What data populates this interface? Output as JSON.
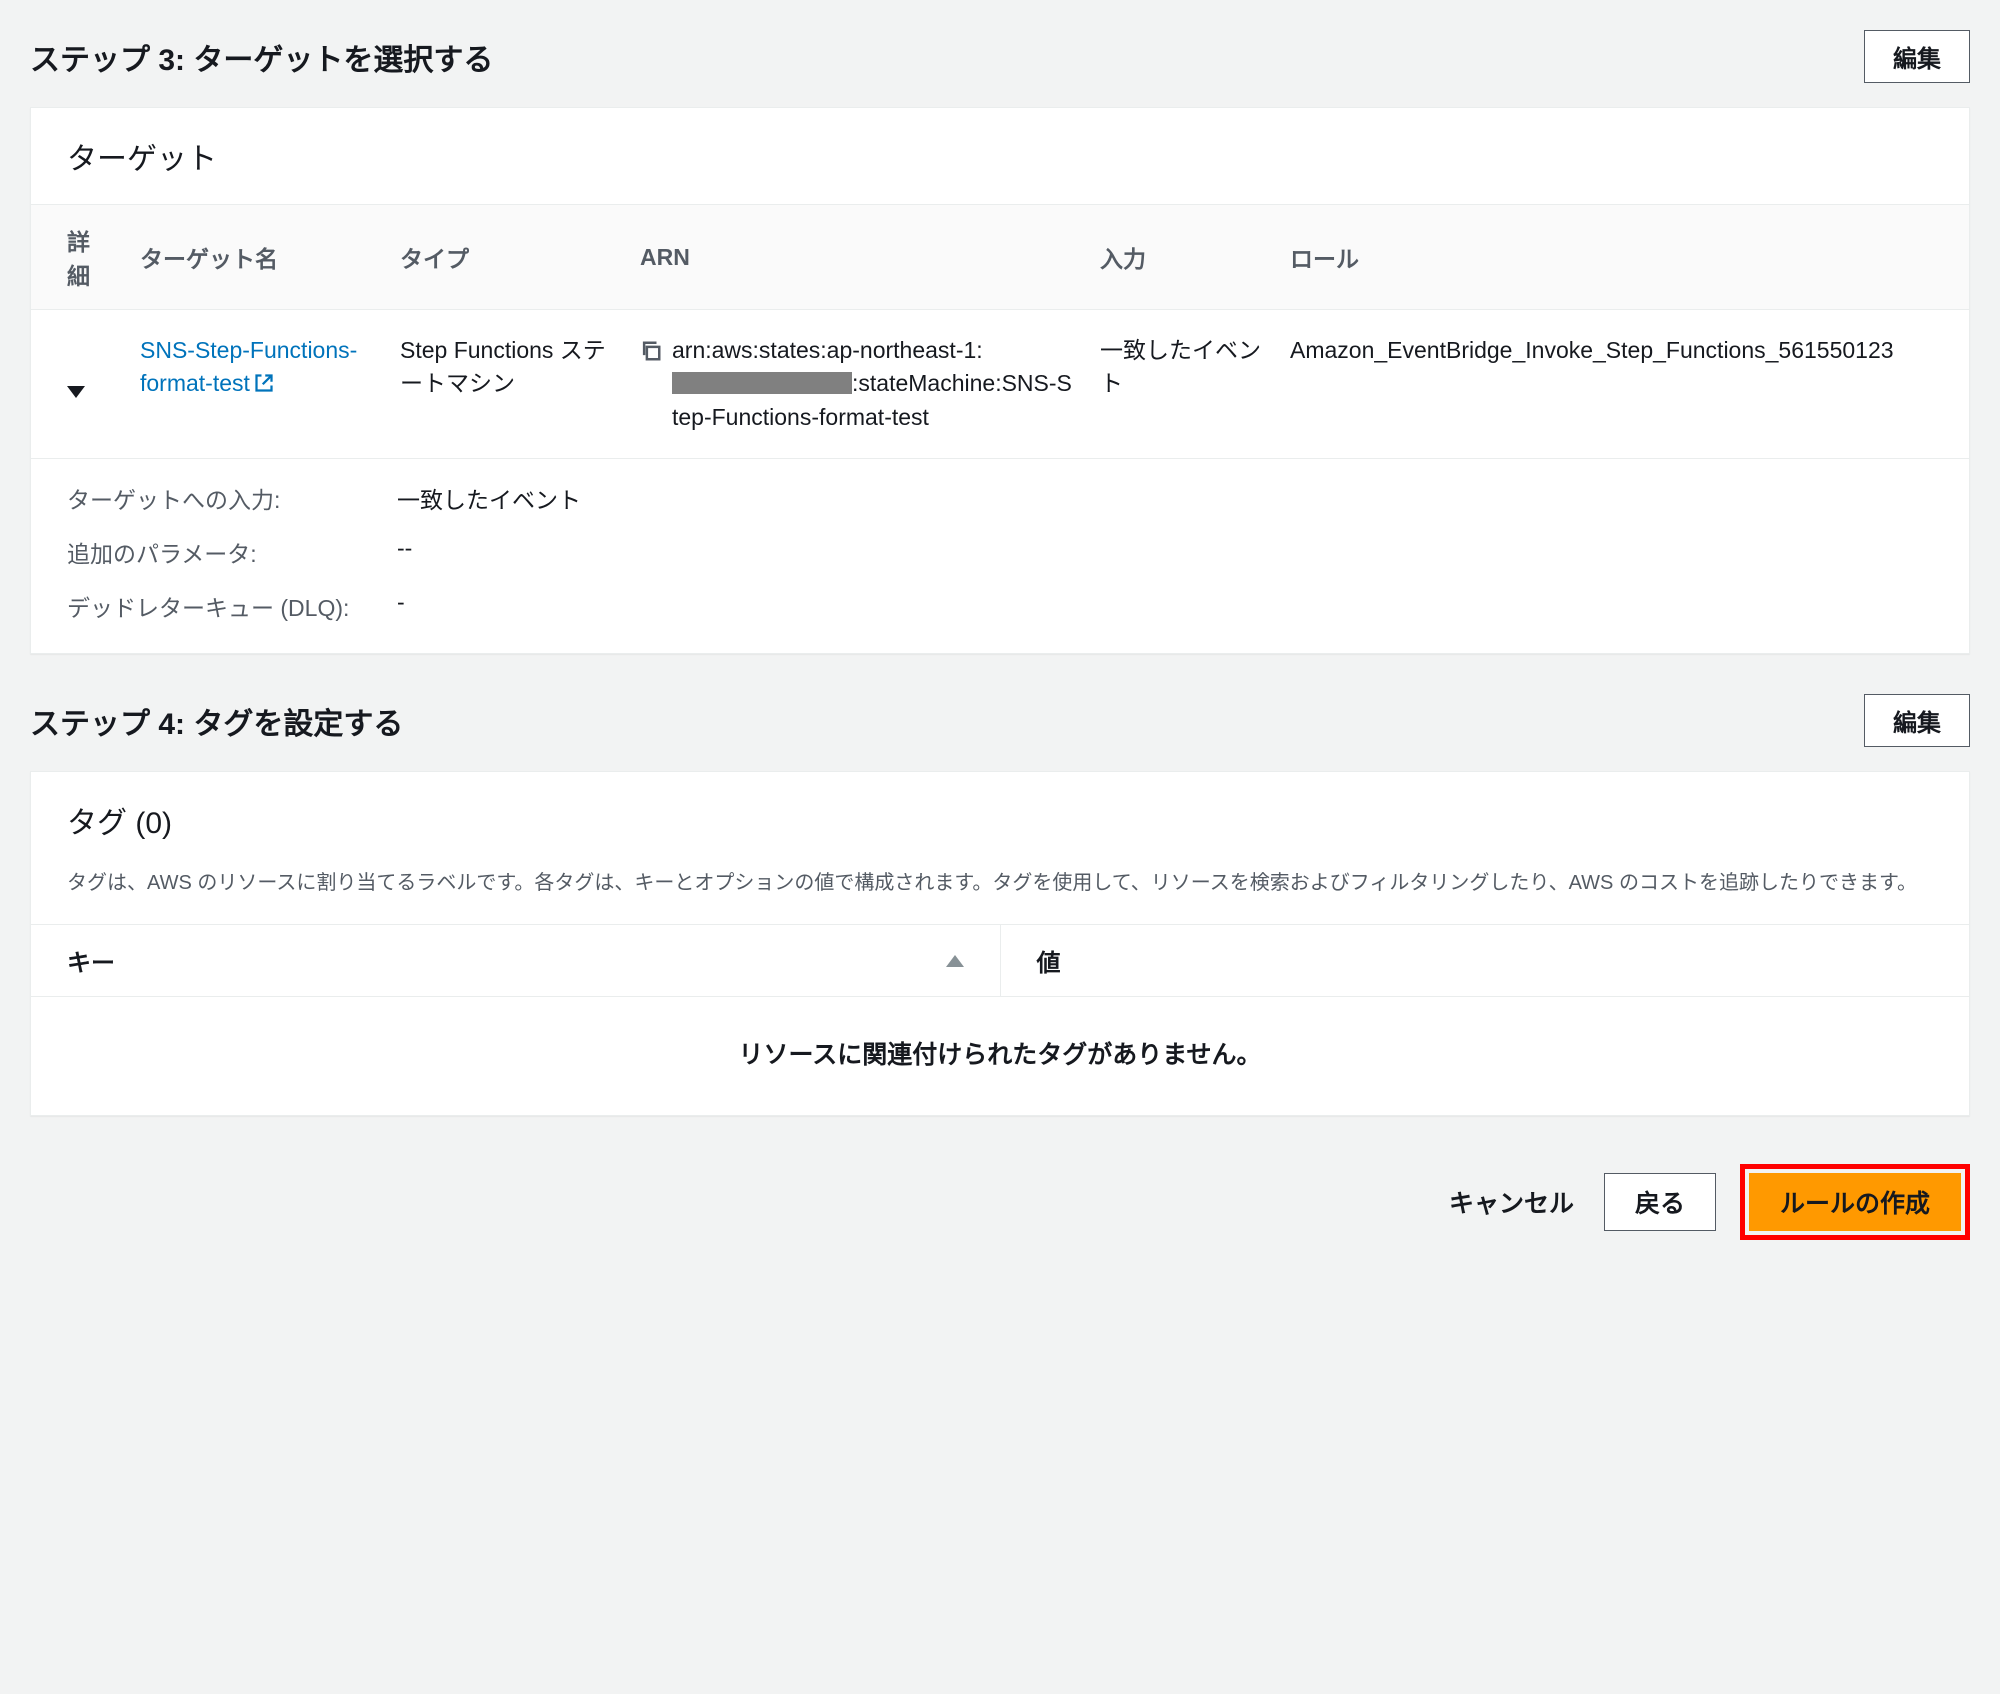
{
  "step3": {
    "title": "ステップ 3: ターゲットを選択する",
    "edit": "編集",
    "panel_title": "ターゲット",
    "columns": {
      "details": "詳細",
      "name": "ターゲット名",
      "type": "タイプ",
      "arn": "ARN",
      "input": "入力",
      "role": "ロール"
    },
    "row": {
      "name": "SNS-Step-Functions-format-test",
      "type": "Step Functions ステートマシン",
      "arn_prefix": "arn:aws:states:ap-northeast-1:",
      "arn_suffix": ":stateMachine:SNS-Step-Functions-format-test",
      "input": "一致したイベント",
      "role": "Amazon_EventBridge_Invoke_Step_Functions_561550123"
    },
    "kv": {
      "target_input_k": "ターゲットへの入力:",
      "target_input_v": "一致したイベント",
      "extra_params_k": "追加のパラメータ:",
      "extra_params_v": "--",
      "dlq_k": "デッドレターキュー (DLQ):",
      "dlq_v": "-"
    }
  },
  "step4": {
    "title": "ステップ 4: タグを設定する",
    "edit": "編集",
    "panel_title": "タグ (0)",
    "panel_desc": "タグは、AWS のリソースに割り当てるラベルです。各タグは、キーとオプションの値で構成されます。タグを使用して、リソースを検索およびフィルタリングしたり、AWS のコストを追跡したりできます。",
    "columns": {
      "key": "キー",
      "value": "値"
    },
    "empty": "リソースに関連付けられたタグがありません。"
  },
  "footer": {
    "cancel": "キャンセル",
    "back": "戻る",
    "create": "ルールの作成"
  }
}
